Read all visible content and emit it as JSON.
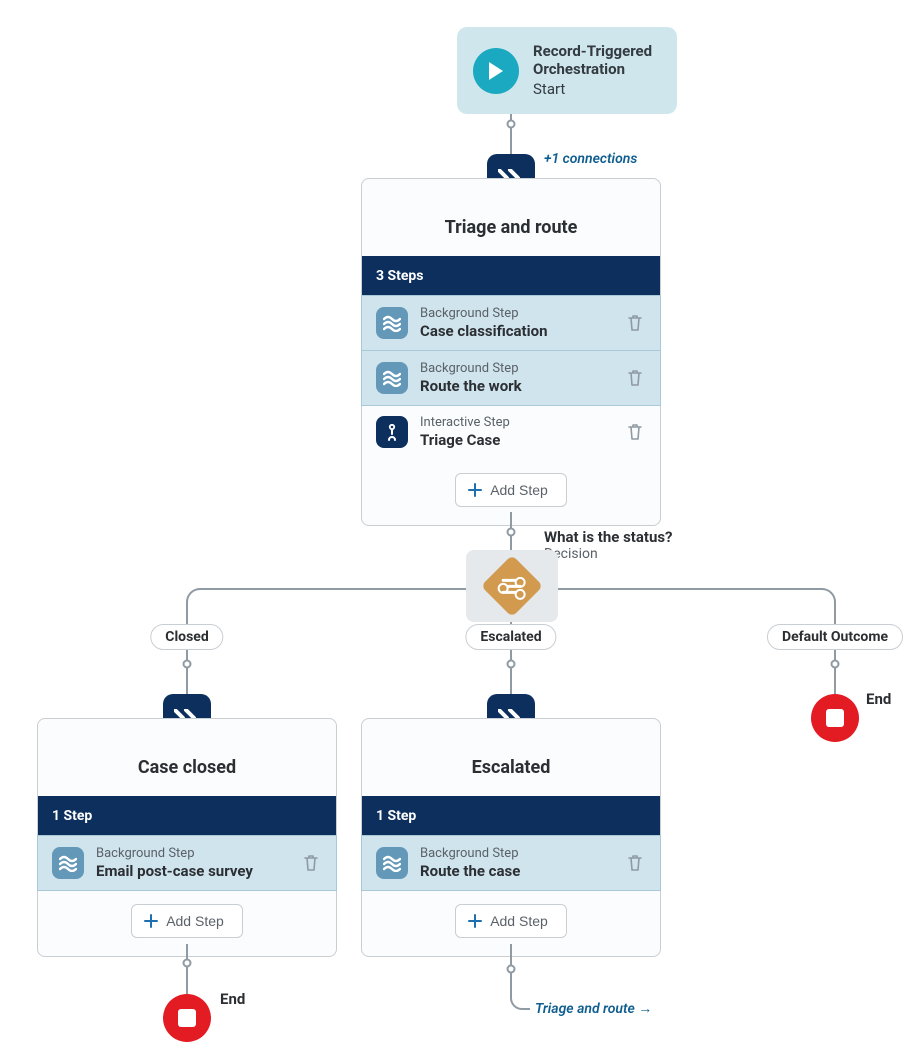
{
  "start": {
    "title_line1": "Record-Triggered",
    "title_line2": "Orchestration",
    "subtitle": "Start"
  },
  "connections_note": "+1 connections",
  "stages": {
    "triage": {
      "title": "Triage and route",
      "steps_label": "3 Steps",
      "steps": [
        {
          "kind": "Background Step",
          "name": "Case classification",
          "type": "background"
        },
        {
          "kind": "Background Step",
          "name": "Route the work",
          "type": "background"
        },
        {
          "kind": "Interactive Step",
          "name": "Triage Case",
          "type": "interactive"
        }
      ],
      "add_label": "Add Step"
    },
    "closed": {
      "title": "Case closed",
      "steps_label": "1 Step",
      "steps": [
        {
          "kind": "Background Step",
          "name": "Email post-case survey",
          "type": "background"
        }
      ],
      "add_label": "Add Step"
    },
    "escalated": {
      "title": "Escalated",
      "steps_label": "1 Step",
      "steps": [
        {
          "kind": "Background Step",
          "name": "Route the case",
          "type": "background"
        }
      ],
      "add_label": "Add Step"
    }
  },
  "decision": {
    "question": "What is the status?",
    "label": "Decision",
    "outcomes": {
      "closed": "Closed",
      "escalated": "Escalated",
      "default": "Default Outcome"
    }
  },
  "end_label": "End",
  "loopback_label": "Triage and route  →"
}
